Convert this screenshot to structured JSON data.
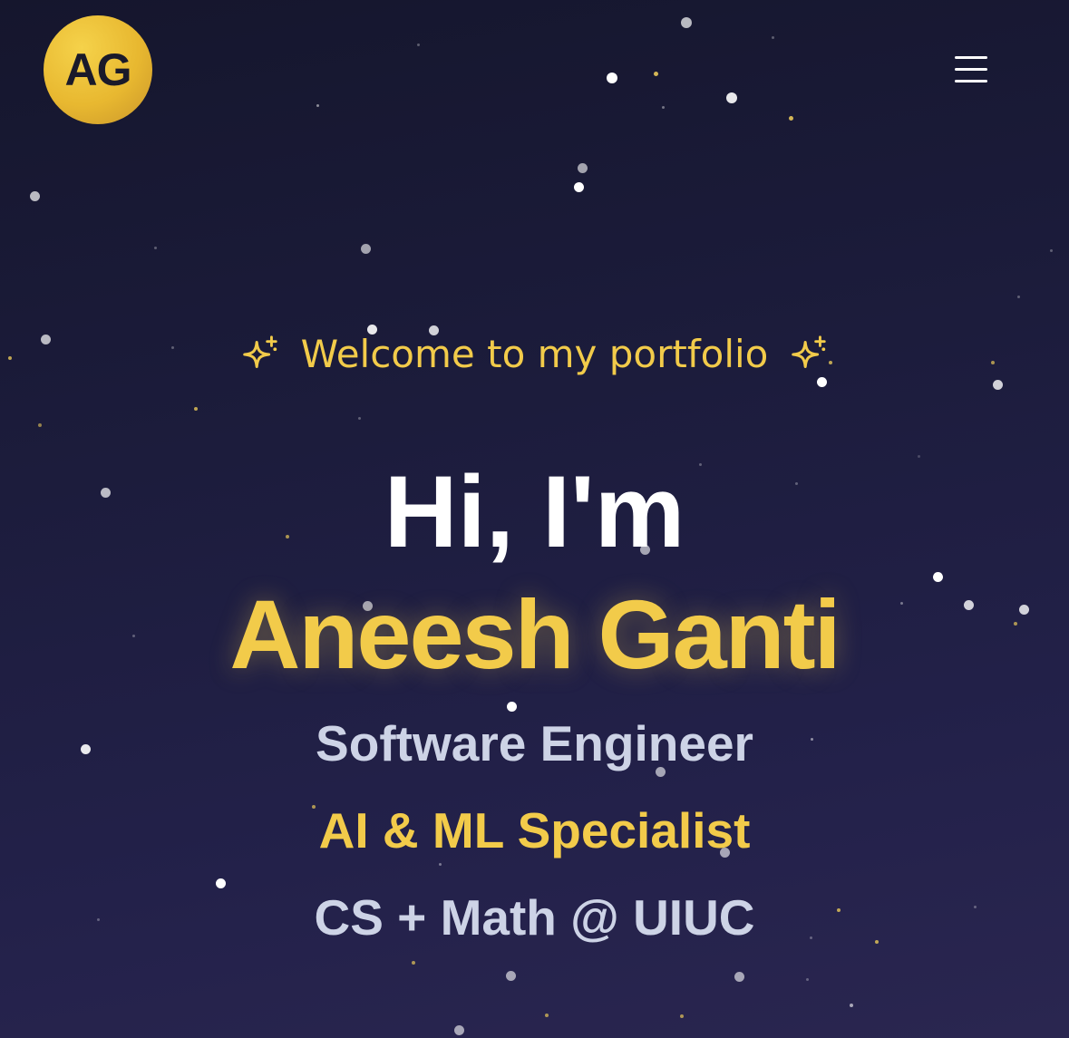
{
  "header": {
    "logo_text": "AG",
    "menu_icon": "hamburger-menu-icon"
  },
  "hero": {
    "welcome_text": "Welcome to my portfolio",
    "greeting": "Hi, I'm",
    "name": "Aneesh Ganti",
    "roles": [
      "Software Engineer",
      "AI & ML Specialist",
      "CS + Math @ UIUC"
    ],
    "sparkle_icon": "sparkle-icon"
  },
  "colors": {
    "background": "#1c1c3c",
    "accent": "#f2cb4a",
    "text_primary": "#ffffff",
    "text_secondary": "#cdd3e6"
  }
}
